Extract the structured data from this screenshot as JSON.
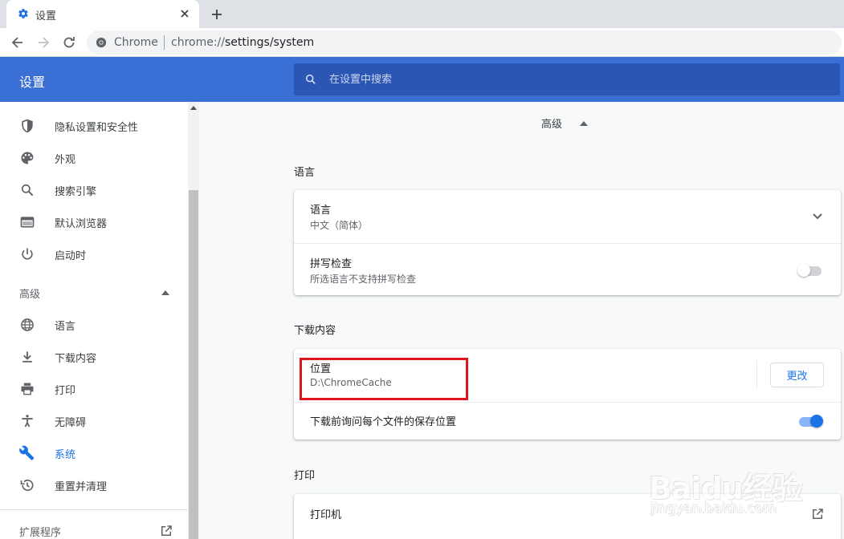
{
  "browser": {
    "tab_title": "设置",
    "site_label": "Chrome",
    "url_scheme": "chrome://",
    "url_path": "settings/system"
  },
  "header": {
    "title": "设置",
    "search_placeholder": "在设置中搜索"
  },
  "sidebar": {
    "items": [
      {
        "label": "隐私设置和安全性",
        "icon": "shield-icon"
      },
      {
        "label": "外观",
        "icon": "palette-icon"
      },
      {
        "label": "搜索引擎",
        "icon": "search-icon"
      },
      {
        "label": "默认浏览器",
        "icon": "browser-window-icon"
      },
      {
        "label": "启动时",
        "icon": "power-icon"
      }
    ],
    "advanced_label": "高级",
    "advanced_items": [
      {
        "label": "语言",
        "icon": "globe-icon"
      },
      {
        "label": "下载内容",
        "icon": "download-icon"
      },
      {
        "label": "打印",
        "icon": "printer-icon"
      },
      {
        "label": "无障碍",
        "icon": "accessibility-icon"
      },
      {
        "label": "系统",
        "icon": "wrench-icon",
        "active": true
      },
      {
        "label": "重置并清理",
        "icon": "history-icon"
      }
    ],
    "extensions_label": "扩展程序"
  },
  "main": {
    "advanced_toggle_label": "高级",
    "languages": {
      "section_title": "语言",
      "language_row_title": "语言",
      "language_row_value": "中文（简体）",
      "spellcheck_title": "拼写检查",
      "spellcheck_sub": "所选语言不支持拼写检查",
      "spellcheck_enabled": false
    },
    "downloads": {
      "section_title": "下载内容",
      "location_title": "位置",
      "location_value": "D:\\ChromeCache",
      "change_button": "更改",
      "ask_title": "下载前询问每个文件的保存位置",
      "ask_enabled": true
    },
    "printing": {
      "section_title": "打印",
      "printers_title": "打印机"
    }
  },
  "watermark": {
    "main": "Baidu经验",
    "sub": "jingyan.baidu.com"
  },
  "colors": {
    "header_blue": "#3a6fd6",
    "search_blue": "#2c56b3",
    "accent": "#1a73e8",
    "highlight_red": "#e0141c"
  }
}
